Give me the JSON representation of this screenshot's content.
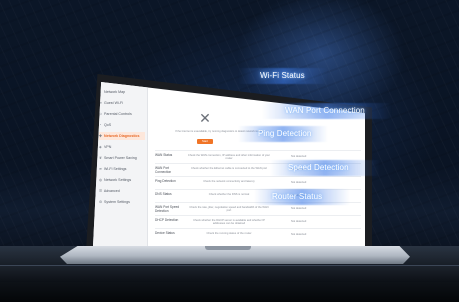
{
  "colors": {
    "accent": "#f07426",
    "background": "#0a1424",
    "callout_glow": "#5aa0ff"
  },
  "callouts": [
    {
      "label": "Wi-Fi Status"
    },
    {
      "label": "WAN Port Connection"
    },
    {
      "label": "Ping Detection"
    },
    {
      "label": "Speed Detection"
    },
    {
      "label": "Router Status"
    }
  ],
  "sidebar": {
    "items": [
      {
        "label": "Network Map",
        "icon": "home-icon"
      },
      {
        "label": "Guest Wi-Fi",
        "icon": "wifi-icon"
      },
      {
        "label": "Parental Controls",
        "icon": "person-icon"
      },
      {
        "label": "QoS",
        "icon": "qos-icon"
      },
      {
        "label": "Network Diagnostics",
        "icon": "stethoscope-icon"
      },
      {
        "label": "VPN",
        "icon": "vpn-icon"
      },
      {
        "label": "Smart Power Saving",
        "icon": "leaf-icon"
      },
      {
        "label": "Wi-Fi Settings",
        "icon": "wifi-settings-icon"
      },
      {
        "label": "Network Settings",
        "icon": "globe-icon"
      },
      {
        "label": "Advanced",
        "icon": "sliders-icon"
      },
      {
        "label": "System Settings",
        "icon": "gear-icon"
      }
    ]
  },
  "main": {
    "hero_text": "If the Internet is unavailable, try running diagnostics to detect network issues",
    "start_label": "Start",
    "diagnostics": [
      {
        "name": "WAN Status",
        "desc": "Check the WAN connection, IP address and other information of your router",
        "status": "Not detected"
      },
      {
        "name": "WAN Port Connection",
        "desc": "Check whether the Ethernet cable is connected to the WAN port",
        "status": "Not detected"
      },
      {
        "name": "Ping Detection",
        "desc": "Check the network connectivity and latency",
        "status": "Not detected"
      },
      {
        "name": "DNS Status",
        "desc": "Check whether the DNS is normal",
        "status": "Not detected"
      },
      {
        "name": "WAN Port Speed Detection",
        "desc": "Check the rate, jitter, negotiation speed and bandwidth of the WAN port",
        "status": "Not detected"
      },
      {
        "name": "DHCP Detection",
        "desc": "Check whether the DHCP server is available and whether IP addresses can be obtained",
        "status": "Not detected"
      },
      {
        "name": "Device Status",
        "desc": "Check the running status of the router",
        "status": "Not detected"
      }
    ]
  }
}
